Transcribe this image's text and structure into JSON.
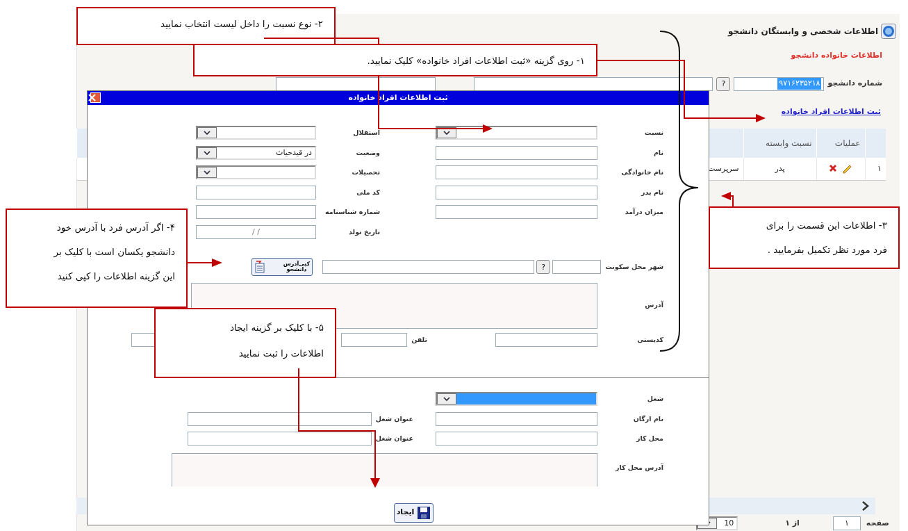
{
  "page": {
    "title": "اطلاعات شخصی و وابستگان دانشجو",
    "subtitle": "اطلاعات خانواده دانشجو",
    "student_number_label": "شماره دانشجو",
    "student_number": "۹۷۱۶۲۳۵۲۱۸",
    "lookup_button": "?",
    "add_link": "ثبت اطلاعات افراد خانواده",
    "table": {
      "columns": [
        "",
        "عملیات",
        "نسبت وابسته"
      ],
      "rows": [
        {
          "index": "۱",
          "relation": "پدر",
          "column_3": "سرپرست"
        }
      ]
    },
    "pager": {
      "page_label": "صفحه",
      "page": "۱",
      "of": "از ۱",
      "page_size": "10"
    }
  },
  "dialog": {
    "title": "ثبت اطلاعات افراد خانواده",
    "rows": [
      {
        "right": {
          "label": "نسبت",
          "kind": "select"
        },
        "left": {
          "label": "استقلال",
          "kind": "select"
        }
      },
      {
        "right": {
          "label": "نام",
          "kind": "text"
        },
        "left": {
          "label": "وضعیت",
          "kind": "select",
          "value": "در قیدحیات"
        }
      },
      {
        "right": {
          "label": "نام خانوادگی",
          "kind": "text"
        },
        "left": {
          "label": "تحصیلات",
          "kind": "select"
        }
      },
      {
        "right": {
          "label": "نام پدر",
          "kind": "text"
        },
        "left": {
          "label": "کد ملی",
          "kind": "text"
        }
      },
      {
        "right": {
          "label": "میزان درآمد",
          "kind": "text"
        },
        "left": {
          "label": "شماره شناسنامه",
          "kind": "text"
        }
      },
      {
        "left": {
          "label": "تاریخ تولد",
          "kind": "date",
          "value": "/   /"
        }
      }
    ],
    "city_label": "شهر محل سکونت",
    "city_lookup": "?",
    "copy_button": [
      "کپی‌آدرس",
      "دانشجو"
    ],
    "address_label": "آدرس",
    "postal_label": "کدپستی",
    "phone_label": "تلفن",
    "job": {
      "label": "شغل",
      "highlighted": true
    },
    "job_rows": [
      {
        "right": "نام ارگان",
        "left": "عنوان شغل"
      },
      {
        "right": "محل کار",
        "left": "عنوان شغل"
      }
    ],
    "work_address_label": "آدرس محل کار",
    "save_button": "ایجاد"
  },
  "callouts": [
    {
      "lines": [
        "۲- نوع نسبت را داخل لیست انتخاب نمایید"
      ]
    },
    {
      "lines": [
        "۱- روی گزینه «ثبت اطلاعات افراد خانواده» کلیک نمایید."
      ]
    },
    {
      "lines": [
        "۳- اطلاعات این قسمت را برای",
        "فرد مورد نظر تکمیل بفرمایید ."
      ]
    },
    {
      "lines": [
        "۴- اگر آدرس فرد با آدرس خود",
        "دانشجو  یکسان است با کلیک بر",
        "این گزینه اطلاعات را کپی کنید"
      ]
    },
    {
      "lines": [
        "۵- با کلیک بر گزینه ایجاد",
        "اطلاعات را ثبت نمایید"
      ]
    }
  ]
}
